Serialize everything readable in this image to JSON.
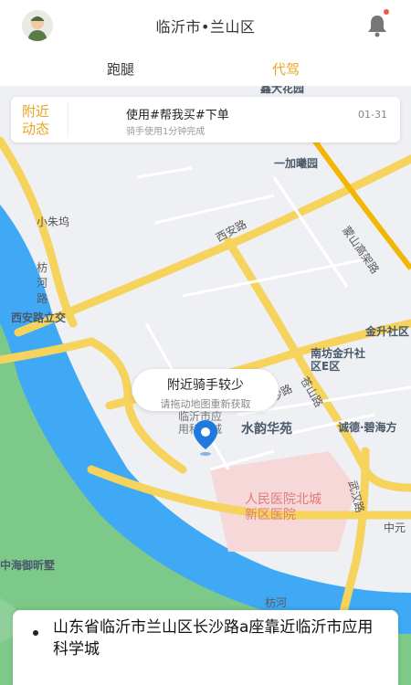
{
  "header": {
    "title": "临沂市•兰山区",
    "avatar_icon": "rider-avatar-icon",
    "bell_icon": "bell-icon"
  },
  "tabs": [
    {
      "label": "跑腿",
      "active": false
    },
    {
      "label": "代驾",
      "active": true
    }
  ],
  "nearby": {
    "label": "附近动态",
    "message": "使用#帮我买#下单",
    "subtitle": "骑手使用1分钟完成",
    "date": "01-31"
  },
  "map": {
    "labels": {
      "huayuan_top": "鑫大花园",
      "yijia": "一加曦园",
      "mengshan": "蒙山高架路",
      "xiaozhu": "小朱坞",
      "xian_road": "西安路",
      "fanghe": "枋河路",
      "xian_bridge": "西安路立交",
      "jinsheng": "金升社区",
      "nanfang": "南坊金升社区E区",
      "cangshan": "苍山路",
      "chengde": "诚德·碧海方",
      "linyi_ke": "临沂市应用科学城",
      "shuiyun": "水韵华苑",
      "hospital": "人民医院北城新区医院",
      "wuhan": "武汉路",
      "zhongyuan": "中元",
      "zhonghai": "中海御昕墅",
      "fanghe_river": "枋河",
      "changsha": "长沙路"
    }
  },
  "bubble": {
    "title": "附近骑手较少",
    "subtitle": "请拖动地图重新获取"
  },
  "address": {
    "text": "山东省临沂市兰山区长沙路a座靠近临沂市应用科学城"
  },
  "colors": {
    "accent": "#e8a623",
    "road": "#f5d35c",
    "river": "#3fa9f5",
    "green": "#6cc27e"
  }
}
